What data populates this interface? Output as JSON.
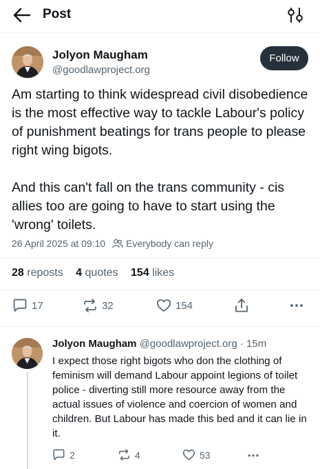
{
  "header": {
    "title": "Post"
  },
  "post": {
    "author_name": "Jolyon Maugham",
    "author_handle": "@goodlawproject.org",
    "follow_label": "Follow",
    "text": "Am starting to think widespread civil disobedience is the most effective way to tackle Labour's policy of punishment beatings for trans people to please right wing bigots.\n\nAnd this can't fall on the trans community - cis allies too are going to have to start using the 'wrong' toilets.",
    "timestamp": "26 April 2025 at 09:10",
    "reply_setting": "Everybody can reply",
    "stats": {
      "reposts_count": "28",
      "reposts_label": "reposts",
      "quotes_count": "4",
      "quotes_label": "quotes",
      "likes_count": "154",
      "likes_label": "likes"
    },
    "actions": {
      "replies": "17",
      "reposts": "32",
      "likes": "154"
    }
  },
  "reply": {
    "author_name": "Jolyon Maugham",
    "author_handle": "@goodlawproject.org",
    "separator": "·",
    "age": "15m",
    "text": "I expect those right bigots who don the clothing of feminism will demand Labour appoint legions of toilet police - diverting still more resource away from the actual issues of violence and coercion of women and children. But Labour has made this bed and it can lie in it.",
    "actions": {
      "replies": "2",
      "reposts": "4",
      "likes": "53"
    }
  },
  "icons": {
    "back": "arrow-left-icon",
    "filter": "sliders-icon",
    "reply": "speech-bubble-icon",
    "repost": "repost-arrows-icon",
    "like": "heart-icon",
    "share": "share-icon",
    "more": "ellipsis-icon",
    "audience": "people-icon"
  },
  "colors": {
    "text": "#0f1419",
    "muted": "#536471",
    "follow_bg": "#26313b"
  }
}
